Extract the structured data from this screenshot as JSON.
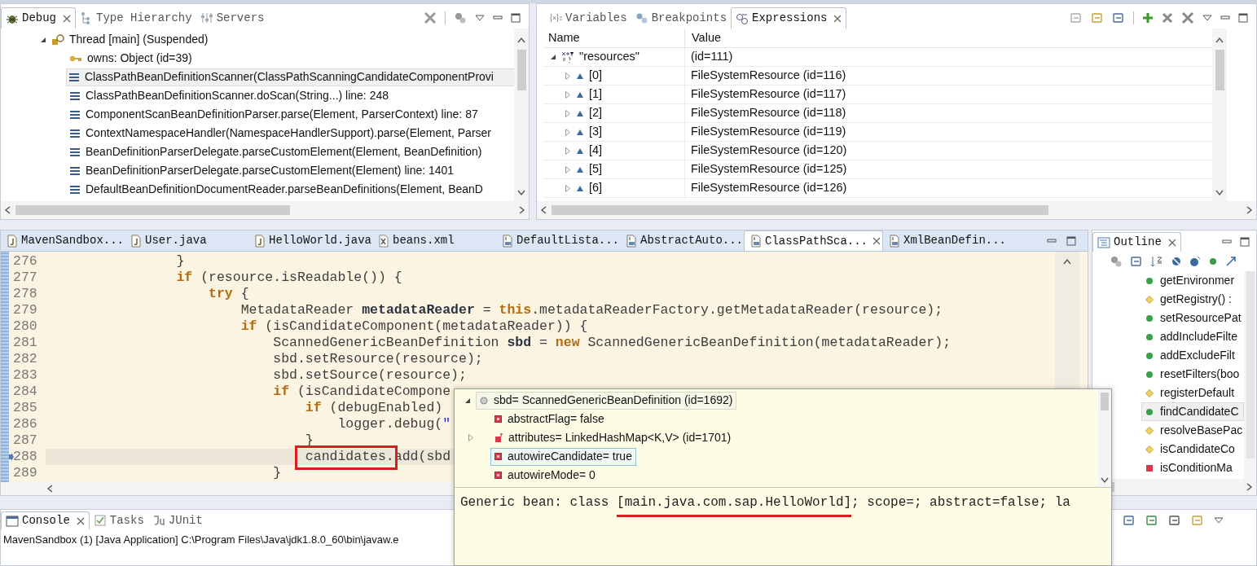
{
  "debug_view": {
    "tabs": [
      {
        "label": "Debug",
        "kind": "debug",
        "selected": true
      },
      {
        "label": "Type Hierarchy",
        "kind": "hierarchy",
        "selected": false
      },
      {
        "label": "Servers",
        "kind": "servers",
        "selected": false
      }
    ],
    "thread": {
      "label": "Thread [main] (Suspended)",
      "expanded": true,
      "children": [
        {
          "kind": "monitor",
          "label": "owns: Object  (id=39)",
          "selected": false
        },
        {
          "kind": "frame",
          "label": "ClassPathBeanDefinitionScanner(ClassPathScanningCandidateComponentProvi",
          "selected": true
        },
        {
          "kind": "frame",
          "label": "ClassPathBeanDefinitionScanner.doScan(String...) line: 248",
          "selected": false
        },
        {
          "kind": "frame",
          "label": "ComponentScanBeanDefinitionParser.parse(Element, ParserContext) line: 87",
          "selected": false
        },
        {
          "kind": "frame",
          "label": "ContextNamespaceHandler(NamespaceHandlerSupport).parse(Element, Parser",
          "selected": false
        },
        {
          "kind": "frame",
          "label": "BeanDefinitionParserDelegate.parseCustomElement(Element, BeanDefinition)",
          "selected": false
        },
        {
          "kind": "frame",
          "label": "BeanDefinitionParserDelegate.parseCustomElement(Element) line: 1401",
          "selected": false
        },
        {
          "kind": "frame",
          "label": "DefaultBeanDefinitionDocumentReader.parseBeanDefinitions(Element, BeanD",
          "selected": false
        }
      ]
    }
  },
  "expressions_view": {
    "tabs": [
      {
        "label": "Variables",
        "kind": "variables",
        "selected": false
      },
      {
        "label": "Breakpoints",
        "kind": "breakpoints",
        "selected": false
      },
      {
        "label": "Expressions",
        "kind": "expressions",
        "selected": true
      }
    ],
    "columns": [
      "Name",
      "Value"
    ],
    "rows": [
      {
        "name": "\"resources\"",
        "value": "(id=111)",
        "expanded": true,
        "children": [
          {
            "name": "[0]",
            "value": "FileSystemResource  (id=116)",
            "expanded": false
          },
          {
            "name": "[1]",
            "value": "FileSystemResource  (id=117)",
            "expanded": false
          },
          {
            "name": "[2]",
            "value": "FileSystemResource  (id=118)",
            "expanded": false
          },
          {
            "name": "[3]",
            "value": "FileSystemResource  (id=119)",
            "expanded": false
          },
          {
            "name": "[4]",
            "value": "FileSystemResource  (id=120)",
            "expanded": false
          },
          {
            "name": "[5]",
            "value": "FileSystemResource  (id=125)",
            "expanded": false
          },
          {
            "name": "[6]",
            "value": "FileSystemResource  (id=126)",
            "expanded": false
          }
        ]
      }
    ]
  },
  "editor": {
    "tabs": [
      {
        "label": "MavenSandbox...",
        "kind": "java",
        "selected": false
      },
      {
        "label": "User.java",
        "kind": "java",
        "selected": false
      },
      {
        "label": "HelloWorld.java",
        "kind": "java",
        "selected": false
      },
      {
        "label": "beans.xml",
        "kind": "xml",
        "selected": false
      },
      {
        "label": "DefaultLista...",
        "kind": "class",
        "selected": false
      },
      {
        "label": "AbstractAuto...",
        "kind": "class",
        "selected": false
      },
      {
        "label": "ClassPathSca...",
        "kind": "class",
        "selected": true
      },
      {
        "label": "XmlBeanDefin...",
        "kind": "class",
        "selected": false
      }
    ],
    "lines": [
      {
        "number": "276",
        "current": false,
        "tokens": [
          {
            "kind": "plain",
            "text": "                }"
          }
        ]
      },
      {
        "number": "277",
        "current": false,
        "tokens": [
          {
            "kind": "keyword",
            "text": "                if"
          },
          {
            "kind": "plain",
            "text": " (resource.isReadable()) {"
          }
        ]
      },
      {
        "number": "278",
        "current": false,
        "tokens": [
          {
            "kind": "keyword",
            "text": "                    try"
          },
          {
            "kind": "plain",
            "text": " {"
          }
        ]
      },
      {
        "number": "279",
        "current": false,
        "tokens": [
          {
            "kind": "plain",
            "text": "                        MetadataReader "
          },
          {
            "kind": "variable",
            "text": "metadataReader"
          },
          {
            "kind": "plain",
            "text": " = "
          },
          {
            "kind": "keyword",
            "text": "this"
          },
          {
            "kind": "plain",
            "text": ".metadataReaderFactory.getMetadataReader(resource);"
          }
        ]
      },
      {
        "number": "280",
        "current": false,
        "tokens": [
          {
            "kind": "keyword",
            "text": "                        if"
          },
          {
            "kind": "plain",
            "text": " (isCandidateComponent(metadataReader)) {"
          }
        ]
      },
      {
        "number": "281",
        "current": false,
        "tokens": [
          {
            "kind": "plain",
            "text": "                            ScannedGenericBeanDefinition "
          },
          {
            "kind": "variable",
            "text": "sbd"
          },
          {
            "kind": "plain",
            "text": " = "
          },
          {
            "kind": "keyword",
            "text": "new"
          },
          {
            "kind": "plain",
            "text": " ScannedGenericBeanDefinition(metadataReader);"
          }
        ]
      },
      {
        "number": "282",
        "current": false,
        "tokens": [
          {
            "kind": "plain",
            "text": "                            sbd.setResource(resource);"
          }
        ]
      },
      {
        "number": "283",
        "current": false,
        "tokens": [
          {
            "kind": "plain",
            "text": "                            sbd.setSource(resource);"
          }
        ]
      },
      {
        "number": "284",
        "current": false,
        "tokens": [
          {
            "kind": "keyword",
            "text": "                            if"
          },
          {
            "kind": "plain",
            "text": " (isCandidateCompone"
          }
        ]
      },
      {
        "number": "285",
        "current": false,
        "tokens": [
          {
            "kind": "keyword",
            "text": "                                if"
          },
          {
            "kind": "plain",
            "text": " (debugEnabled)"
          }
        ]
      },
      {
        "number": "286",
        "current": false,
        "tokens": [
          {
            "kind": "plain",
            "text": "                                    logger.debug("
          },
          {
            "kind": "string",
            "text": "\""
          }
        ]
      },
      {
        "number": "287",
        "current": false,
        "tokens": [
          {
            "kind": "plain",
            "text": "                                }"
          }
        ]
      },
      {
        "number": "288",
        "current": true,
        "tokens": [
          {
            "kind": "plain",
            "text": "                                candidates.",
            "boxed": true
          },
          {
            "kind": "plain",
            "text": "add(sbd"
          }
        ]
      },
      {
        "number": "289",
        "current": false,
        "tokens": [
          {
            "kind": "plain",
            "text": "                            }"
          }
        ]
      }
    ]
  },
  "outline": {
    "tabs": [
      {
        "label": "Outline",
        "kind": "outline",
        "selected": true
      }
    ],
    "items": [
      {
        "label": "getEnvironmer",
        "kind": "public",
        "selected": false
      },
      {
        "label": "getRegistry() :",
        "kind": "protected",
        "selected": false
      },
      {
        "label": "setResourcePat",
        "kind": "public",
        "selected": false
      },
      {
        "label": "addIncludeFilte",
        "kind": "public",
        "selected": false
      },
      {
        "label": "addExcludeFilt",
        "kind": "public",
        "selected": false
      },
      {
        "label": "resetFilters(boo",
        "kind": "public",
        "selected": false
      },
      {
        "label": "registerDefault",
        "kind": "protected",
        "selected": false
      },
      {
        "label": "findCandidateC",
        "kind": "public",
        "selected": true
      },
      {
        "label": "resolveBasePac",
        "kind": "protected",
        "selected": false
      },
      {
        "label": "isCandidateCo",
        "kind": "protected",
        "selected": false
      },
      {
        "label": "isConditionMa",
        "kind": "private",
        "selected": false
      }
    ]
  },
  "console": {
    "tabs": [
      {
        "label": "Console",
        "kind": "console",
        "selected": true
      },
      {
        "label": "Tasks",
        "kind": "tasks",
        "selected": false
      },
      {
        "label": "JUnit",
        "kind": "junit",
        "selected": false
      }
    ],
    "text": "MavenSandbox (1) [Java Application] C:\\Program Files\\Java\\jdk1.8.0_60\\bin\\javaw.e"
  },
  "hover": {
    "tree": [
      {
        "kind": "object",
        "label": "sbd= ScannedGenericBeanDefinition  (id=1692)",
        "expanded": true,
        "selected": false
      },
      {
        "kind": "field",
        "label": "abstractFlag= false",
        "selected": false
      },
      {
        "kind": "collection",
        "label": "attributes= LinkedHashMap<K,V>  (id=1701)",
        "expanded": false,
        "selected": false
      },
      {
        "kind": "field",
        "label": "autowireCandidate= true",
        "selected": true
      },
      {
        "kind": "field",
        "label": "autowireMode= 0",
        "selected": false
      }
    ],
    "detail": [
      {
        "text": "Generic bean: class ",
        "underlined": false
      },
      {
        "text": "[main.java.com.sap.HelloWorld]",
        "underlined": true
      },
      {
        "text": "; scope=; abstract=false; la",
        "underlined": false
      }
    ]
  }
}
